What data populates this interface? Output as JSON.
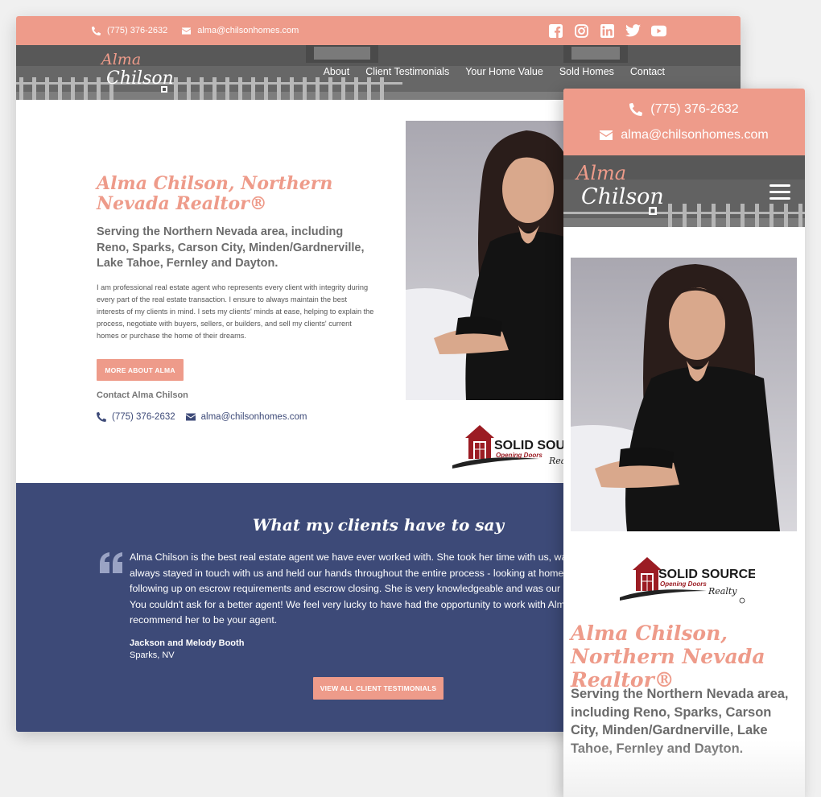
{
  "brand": {
    "logo_line1": "Alma",
    "logo_line2": "Chilson",
    "coral": "#ee9b8a",
    "navy": "#3d4a78"
  },
  "contact": {
    "phone": "(775) 376-2632",
    "email": "alma@chilsonhomes.com"
  },
  "social_icons": [
    "facebook-icon",
    "instagram-icon",
    "linkedin-icon",
    "twitter-icon",
    "youtube-icon"
  ],
  "nav": {
    "items": [
      "About",
      "Client Testimonials",
      "Your Home Value",
      "Sold Homes",
      "Contact"
    ]
  },
  "hero": {
    "title": "Alma Chilson, Northern Nevada Realtor®",
    "subtitle": "Serving the Northern Nevada area, including Reno, Sparks, Carson City, Minden/Gardnerville, Lake Tahoe, Fernley and Dayton.",
    "body": "I am professional real estate agent who represents every client with integrity during every part of the real estate transaction. I ensure to always maintain the best interests of my clients in mind. I sets my clients' minds at ease, helping to explain the process, negotiate with buyers, sellers, or builders, and sell my clients' current homes or purchase the home of their dreams.",
    "more_button": "MORE ABOUT ALMA",
    "contact_label": "Contact Alma Chilson"
  },
  "brokerage": {
    "name": "SOLID SOURCE",
    "name_mobile": "SOLID SOURCE",
    "tagline": "Opening Doors",
    "script": "Realty"
  },
  "testimonials": {
    "heading": "What my clients have to say",
    "quote_lines": [
      "Alma Chilson is the best real estate agent we have ever worked with. She took her time with us, was r",
      "always stayed in touch with us and held our hands throughout the entire process - looking at homes,",
      "following up on escrow requirements and escrow closing. She is very knowledgeable and was our ad",
      "You couldn't ask for a better agent! We feel very lucky to have had the opportunity to work with Alma",
      "recommend her to be your agent."
    ],
    "author": "Jackson and Melody Booth",
    "location": "Sparks, NV",
    "view_all_button": "VIEW ALL CLIENT TESTIMONIALS"
  }
}
